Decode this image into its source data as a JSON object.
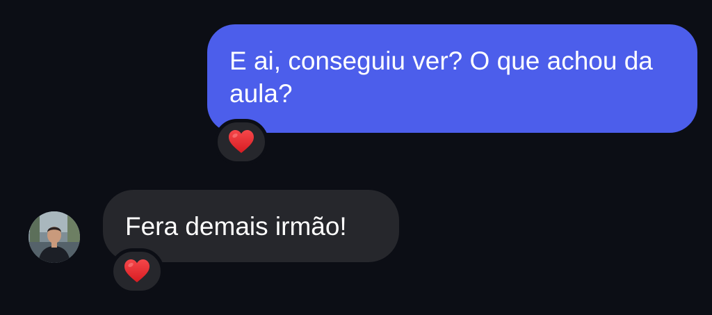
{
  "messages": [
    {
      "direction": "outgoing",
      "text": "E ai, conseguiu ver? O que achou da aula?",
      "reaction": "heart-icon"
    },
    {
      "direction": "incoming",
      "text": "Fera demais irmão!",
      "reaction": "heart-icon",
      "avatar": "contact-avatar-photo"
    }
  ],
  "colors": {
    "background": "#0c0e15",
    "outgoing_bubble": "#4c5eeb",
    "incoming_bubble": "#26272c",
    "text": "#ffffff",
    "heart": "#e8262b"
  }
}
